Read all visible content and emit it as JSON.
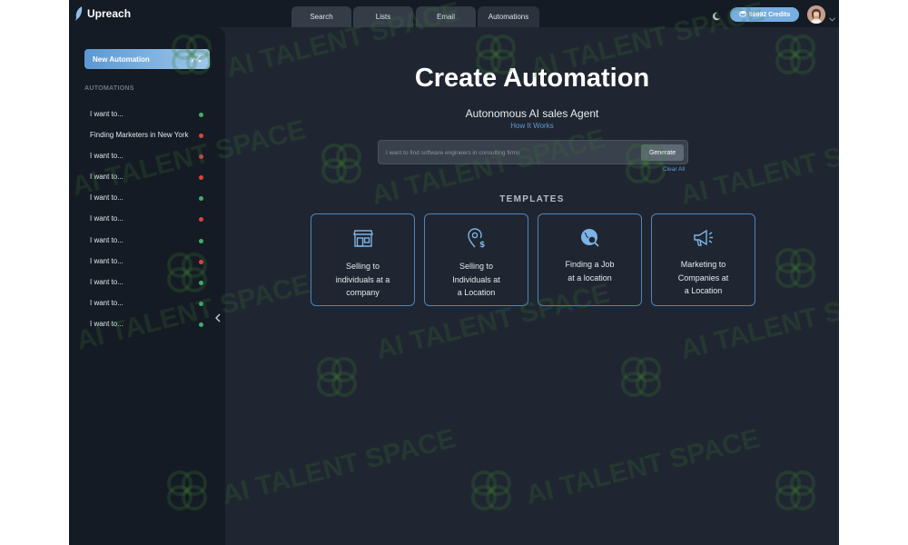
{
  "app": {
    "name": "Upreach"
  },
  "nav": {
    "tabs": [
      {
        "label": "Search",
        "active": false
      },
      {
        "label": "Lists",
        "active": false
      },
      {
        "label": "Email",
        "active": false
      },
      {
        "label": "Automations",
        "active": true
      }
    ]
  },
  "header": {
    "credits": "99992 Credits",
    "theme_icon": "moon-icon",
    "avatar_icon": "user-avatar"
  },
  "sidebar": {
    "new_automation_label": "New Automation",
    "section_title": "AUTOMATIONS",
    "items": [
      {
        "label": "I want to...",
        "status": "green"
      },
      {
        "label": "Finding Marketers in New York",
        "status": "red"
      },
      {
        "label": "I want to...",
        "status": "red"
      },
      {
        "label": "I want to...",
        "status": "red"
      },
      {
        "label": "I want to...",
        "status": "green"
      },
      {
        "label": "I want to...",
        "status": "red"
      },
      {
        "label": "I want to...",
        "status": "green"
      },
      {
        "label": "I want to...",
        "status": "red"
      },
      {
        "label": "I want to...",
        "status": "green"
      },
      {
        "label": "I want to...",
        "status": "green"
      },
      {
        "label": "I want to...",
        "status": "green"
      }
    ]
  },
  "main": {
    "title": "Create Automation",
    "subtitle": "Autonomous AI sales Agent",
    "how_it_works": "How It Works",
    "search": {
      "placeholder": "I want to find software engineers in consulting firms",
      "value": ""
    },
    "generate_label": "Generate",
    "clear_all_label": "Clear All",
    "templates_heading": "TEMPLATES",
    "templates": [
      {
        "label": "Selling to\nindividuals at a\ncompany",
        "icon": "storefront-icon"
      },
      {
        "label": "Selling to\nIndividuals at\na Location",
        "icon": "location-dollar-icon"
      },
      {
        "label": "Finding a Job\nat a location",
        "icon": "globe-search-icon"
      },
      {
        "label": "Marketing to\nCompanies at\na Location",
        "icon": "megaphone-icon"
      }
    ]
  },
  "watermark": {
    "text": "AI TALENT SPACE"
  },
  "colors": {
    "background": "#1f2631",
    "sidebar": "#151b24",
    "accent": "#5d9ad6",
    "status_green": "#3fae6a",
    "status_red": "#d9453d"
  }
}
